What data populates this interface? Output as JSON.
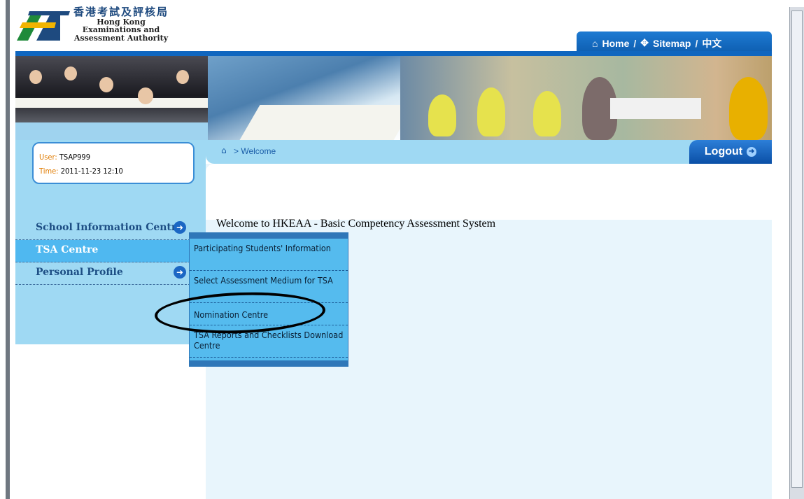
{
  "header": {
    "org_name_cn": "香港考試及評核局",
    "org_name_en_line1": "Hong Kong",
    "org_name_en_line2": "Examinations and",
    "org_name_en_line3": "Assessment Authority",
    "nav": {
      "home": "Home",
      "sitemap": "Sitemap",
      "lang": "中文",
      "separator": "/"
    }
  },
  "user_info": {
    "user_label": "User:",
    "user_value": "TSAP999",
    "time_label": "Time:",
    "time_value": "2011-11-23 12:10"
  },
  "breadcrumb": {
    "text": "> Welcome"
  },
  "logout_label": "Logout",
  "sidebar": {
    "items": [
      {
        "label": "School Information Centre"
      },
      {
        "label": "TSA Centre"
      },
      {
        "label": "Personal Profile"
      }
    ]
  },
  "submenu": {
    "items": [
      {
        "label": "Participating Students' Information"
      },
      {
        "label": "Select Assessment Medium for TSA"
      },
      {
        "label": "Nomination Centre"
      },
      {
        "label": "TSA Reports and Checklists Download Centre"
      }
    ]
  },
  "welcome_text": "Welcome to HKEAA - Basic Competency Assessment System",
  "colors": {
    "accent": "#0f66bf",
    "sidebar_bg": "#9fd9f3",
    "submenu_bg": "#55bbee",
    "label_orange": "#e07b00"
  }
}
